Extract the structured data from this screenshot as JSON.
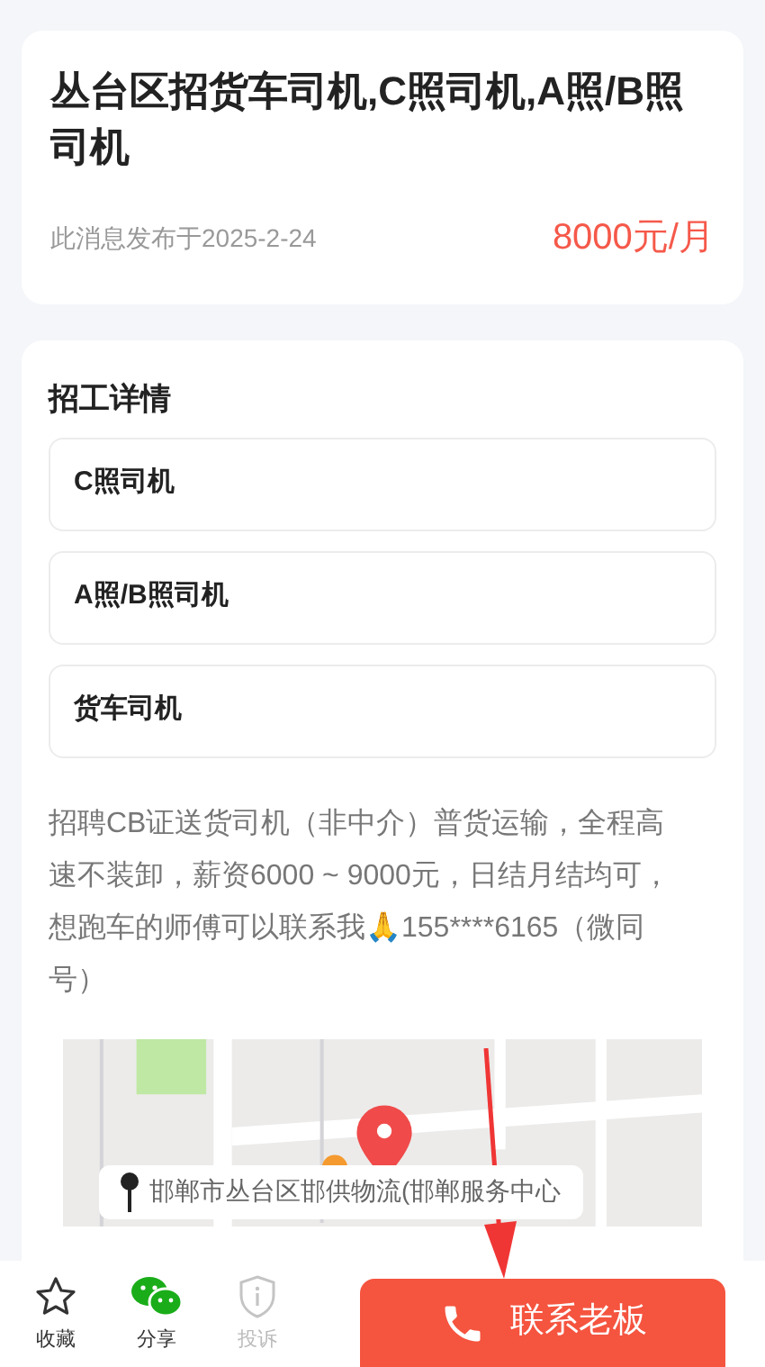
{
  "job": {
    "title": "丛台区招货车司机,C照司机,A照/B照司机",
    "posted": "此消息发布于2025-2-24",
    "salary": "8000元/月"
  },
  "details": {
    "heading": "招工详情",
    "tags": [
      "C照司机",
      "A照/B照司机",
      "货车司机"
    ],
    "description": "招聘CB证送货司机（非中介）普货运输，全程高速不装卸，薪资6000 ~ 9000元，日结月结均可，想跑车的师傅可以联系我🙏155****6165（微同号）"
  },
  "map": {
    "address": "邯郸市丛台区邯供物流(邯郸服务中心"
  },
  "bottom_bar": {
    "actions": [
      {
        "kind": "star",
        "label": "收藏",
        "disabled": false
      },
      {
        "kind": "chat",
        "label": "分享",
        "disabled": false
      },
      {
        "kind": "shield",
        "label": "投诉",
        "disabled": true
      }
    ],
    "contact_button": "联系老板"
  }
}
